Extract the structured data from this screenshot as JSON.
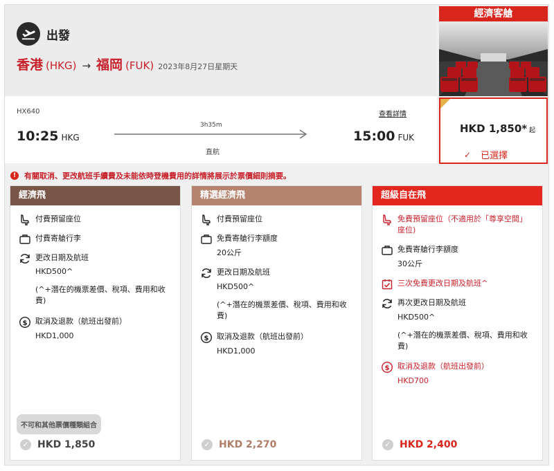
{
  "header": {
    "direction_label": "出發",
    "origin_city": "香港",
    "origin_code": "(HKG)",
    "arrow": "→",
    "destination_city": "福岡",
    "destination_code": "(FUK)",
    "date": "2023年8月27日星期天"
  },
  "cabin": {
    "title": "經濟客艙",
    "image_icon": "cabin-seats-photo"
  },
  "flight": {
    "number": "HX640",
    "details_link": "查看詳情",
    "departure_time": "10:25",
    "departure_code": "HKG",
    "duration": "3h35m",
    "stops": "直航",
    "arrival_time": "15:00",
    "arrival_code": "FUK"
  },
  "selected_price": {
    "price": "HKD 1,850*",
    "from_label": "起",
    "selected_label": "已選擇"
  },
  "notice": {
    "text": "有關取消、更改航班手續費及未能依時登機費用的詳情將展示於票價細則摘要。"
  },
  "fares": [
    {
      "name": "經濟飛",
      "seat": "付費預留座位",
      "baggage": "付費寄艙行李",
      "change_title": "更改日期及航班",
      "change_fee": "HKD500^",
      "change_note": "(^+潛在的機票差價、稅項、費用和收費)",
      "refund_title": "取消及退款（航班出發前）",
      "refund_fee": "HKD1,000",
      "combo_note": "不可和其他票價種類組合",
      "price": "HKD 1,850"
    },
    {
      "name": "精選經濟飛",
      "seat": "付費預留座位",
      "baggage": "免費寄艙行李額度",
      "baggage_weight": "20公斤",
      "change_title": "更改日期及航班",
      "change_fee": "HKD500^",
      "change_note": "(^+潛在的機票差價、稅項、費用和收費)",
      "refund_title": "取消及退款（航班出發前）",
      "refund_fee": "HKD1,000",
      "price": "HKD 2,270"
    },
    {
      "name": "超級自在飛",
      "seat": "免費預留座位（不適用於「尊享空間」座位)",
      "baggage": "免費寄艙行李額度",
      "baggage_weight": "30公斤",
      "free_change": "三次免費更改日期及航班^",
      "change_title": "再次更改日期及航班",
      "change_fee": "HKD500^",
      "change_note": "(^+潛在的機票差價、稅項、費用和收費)",
      "refund_title": "取消及退款（航班出發前）",
      "refund_fee": "HKD700",
      "price": "HKD 2,400"
    }
  ],
  "colors": {
    "brand_red": "#d9261c",
    "fare1": "#795548",
    "fare2": "#b6836f",
    "fare3": "#e3271f"
  }
}
